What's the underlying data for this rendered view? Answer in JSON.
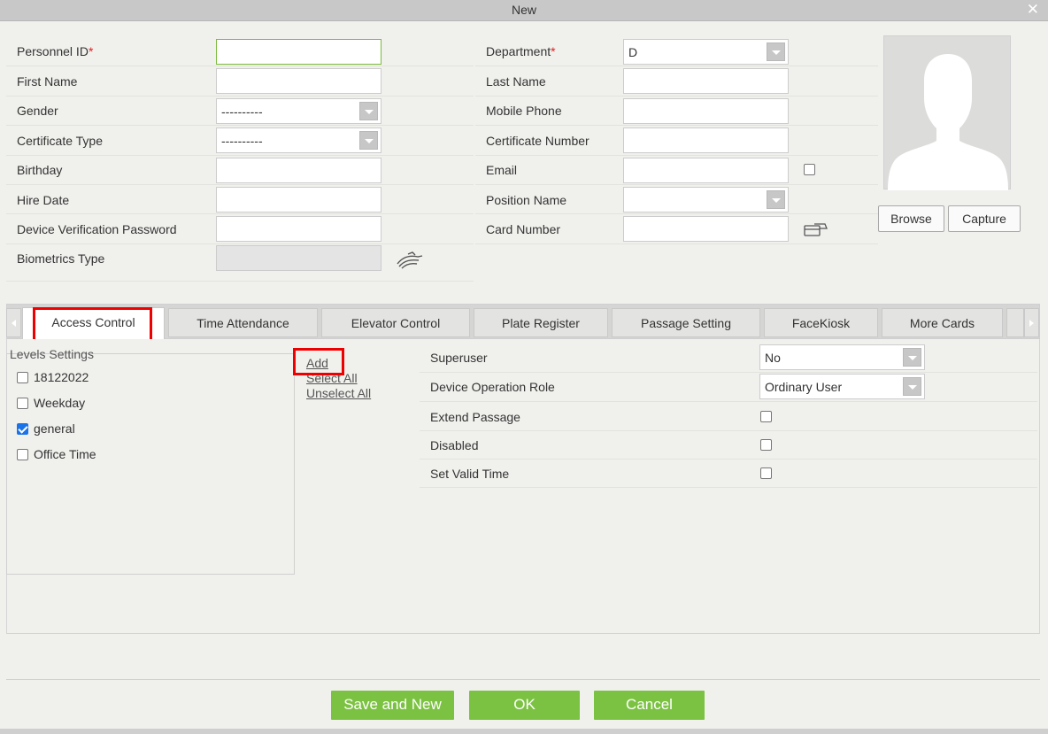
{
  "dialog": {
    "title": "New",
    "close_glyph": "✕"
  },
  "form_left": [
    {
      "label": "Personnel ID",
      "required": "*",
      "type": "text",
      "value": ""
    },
    {
      "label": "First Name",
      "type": "text",
      "value": ""
    },
    {
      "label": "Gender",
      "type": "select",
      "value": "----------"
    },
    {
      "label": "Certificate Type",
      "type": "select",
      "value": "----------"
    },
    {
      "label": "Birthday",
      "type": "text",
      "value": ""
    },
    {
      "label": "Hire Date",
      "type": "text",
      "value": ""
    },
    {
      "label": "Device Verification Password",
      "type": "text",
      "value": ""
    },
    {
      "label": "Biometrics Type",
      "type": "text",
      "value": "",
      "disabled": true
    }
  ],
  "form_right": [
    {
      "label": "Department",
      "required": "*",
      "type": "select",
      "value": "D"
    },
    {
      "label": "Last Name",
      "type": "text",
      "value": ""
    },
    {
      "label": "Mobile Phone",
      "type": "text",
      "value": ""
    },
    {
      "label": "Certificate Number",
      "type": "text",
      "value": ""
    },
    {
      "label": "Email",
      "type": "text",
      "value": ""
    },
    {
      "label": "Position Name",
      "type": "select",
      "value": ""
    },
    {
      "label": "Card Number",
      "type": "text",
      "value": ""
    }
  ],
  "photo": {
    "browse_label": "Browse",
    "capture_label": "Capture"
  },
  "tabs": [
    {
      "label": "Access Control",
      "active": true
    },
    {
      "label": "Time Attendance"
    },
    {
      "label": "Elevator Control"
    },
    {
      "label": "Plate Register"
    },
    {
      "label": "Passage Setting"
    },
    {
      "label": "FaceKiosk"
    },
    {
      "label": "More Cards"
    }
  ],
  "levels": {
    "title": "Levels Settings",
    "items": [
      {
        "label": "18122022",
        "checked": false
      },
      {
        "label": "Weekday",
        "checked": false
      },
      {
        "label": "general",
        "checked": true
      },
      {
        "label": "Office Time",
        "checked": false
      }
    ],
    "add_label": "Add",
    "select_all_label": "Select All",
    "unselect_all_label": "Unselect All"
  },
  "access_settings": [
    {
      "label": "Superuser",
      "type": "select",
      "value": "No"
    },
    {
      "label": "Device Operation Role",
      "type": "select",
      "value": "Ordinary User"
    },
    {
      "label": "Extend Passage",
      "type": "checkbox",
      "checked": false
    },
    {
      "label": "Disabled",
      "type": "checkbox",
      "checked": false
    },
    {
      "label": "Set Valid Time",
      "type": "checkbox",
      "checked": false
    }
  ],
  "footer": {
    "save_new_label": "Save and New",
    "ok_label": "OK",
    "cancel_label": "Cancel"
  },
  "colors": {
    "accent_green": "#7cc242",
    "highlight_red": "#ee0000",
    "required_red": "#e02020"
  }
}
